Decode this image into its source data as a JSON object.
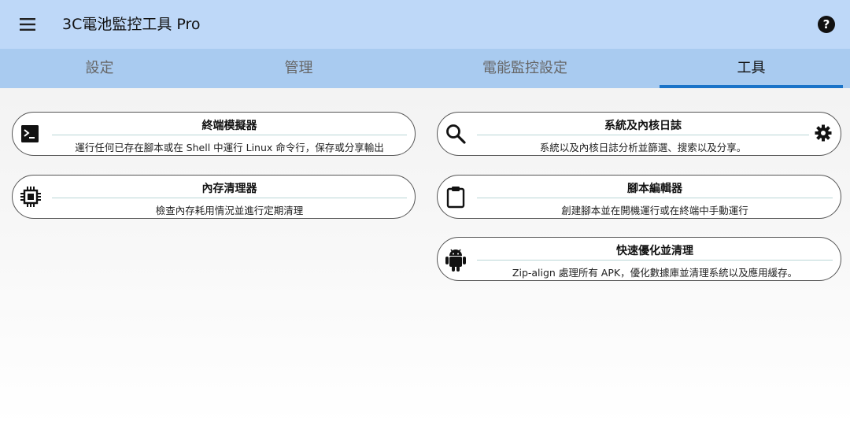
{
  "app": {
    "title": "3C電池監控工具 Pro",
    "menu_icon": "hamburger-menu-icon",
    "help_icon": "help-circle-icon"
  },
  "tabs": [
    {
      "label": "設定",
      "active": false
    },
    {
      "label": "管理",
      "active": false
    },
    {
      "label": "電能監控設定",
      "active": false
    },
    {
      "label": "工具",
      "active": true
    }
  ],
  "tools": {
    "terminal": {
      "title": "終端模擬器",
      "description": "運行任何已存在腳本或在 Shell 中運行 Linux 命令行，保存或分享輸出",
      "icon": "terminal-icon"
    },
    "memory": {
      "title": "內存清理器",
      "description": "檢查內存耗用情況並進行定期清理",
      "icon": "chip-icon"
    },
    "logs": {
      "title": "系統及內核日誌",
      "description": "系統以及內核日誌分析並篩選、搜索以及分享。",
      "icon": "search-icon",
      "settings_icon": "gear-icon"
    },
    "script_editor": {
      "title": "腳本編輯器",
      "description": "創建腳本並在開機運行或在終端中手動運行",
      "icon": "clipboard-icon"
    },
    "optimizer": {
      "title": "快速優化並清理",
      "description": "Zip-align 處理所有 APK，優化數據庫並清理系統以及應用緩存。",
      "icon": "android-icon"
    }
  },
  "colors": {
    "appbar": "#bed8f8",
    "tabbar": "#a9cbf0",
    "tab_indicator": "#1a73c8"
  }
}
